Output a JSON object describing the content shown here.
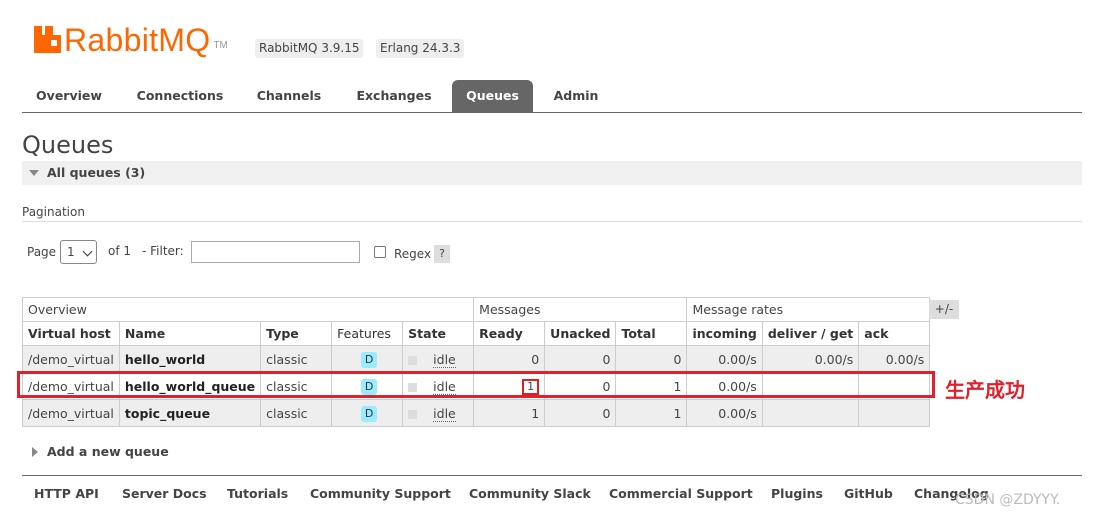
{
  "header": {
    "logo_text": "RabbitMQ",
    "logo_tm": "TM",
    "version": "RabbitMQ 3.9.15",
    "erlang": "Erlang 24.3.3"
  },
  "nav": {
    "tabs": [
      "Overview",
      "Connections",
      "Channels",
      "Exchanges",
      "Queues",
      "Admin"
    ],
    "active": "Queues"
  },
  "page": {
    "title": "Queues",
    "section": "All queues (3)"
  },
  "pagination": {
    "label": "Pagination",
    "page_label": "Page",
    "page_value": "1",
    "of_label": "of 1",
    "filter_label": "- Filter:",
    "filter_value": "",
    "regex_label": "Regex",
    "help": "?"
  },
  "table": {
    "groups": {
      "overview": "Overview",
      "messages": "Messages",
      "rates": "Message rates"
    },
    "columns": [
      "Virtual host",
      "Name",
      "Type",
      "Features",
      "State",
      "Ready",
      "Unacked",
      "Total",
      "incoming",
      "deliver / get",
      "ack"
    ],
    "toggle": "+/-",
    "rows": [
      {
        "vhost": "/demo_virtual",
        "name": "hello_world",
        "type": "classic",
        "feature": "D",
        "state": "idle",
        "ready": "0",
        "unacked": "0",
        "total": "0",
        "incoming": "0.00/s",
        "deliver": "0.00/s",
        "ack": "0.00/s"
      },
      {
        "vhost": "/demo_virtual",
        "name": "hello_world_queue",
        "type": "classic",
        "feature": "D",
        "state": "idle",
        "ready": "1",
        "unacked": "0",
        "total": "1",
        "incoming": "0.00/s",
        "deliver": "",
        "ack": ""
      },
      {
        "vhost": "/demo_virtual",
        "name": "topic_queue",
        "type": "classic",
        "feature": "D",
        "state": "idle",
        "ready": "1",
        "unacked": "0",
        "total": "1",
        "incoming": "0.00/s",
        "deliver": "",
        "ack": ""
      }
    ]
  },
  "annotation": {
    "text": "生产成功",
    "color": "#e0202a"
  },
  "add_queue": "Add a new queue",
  "footer": {
    "links": [
      "HTTP API",
      "Server Docs",
      "Tutorials",
      "Community Support",
      "Community Slack",
      "Commercial Support",
      "Plugins",
      "GitHub",
      "Changelog"
    ]
  },
  "watermark": "CSDN @ZDYYY."
}
